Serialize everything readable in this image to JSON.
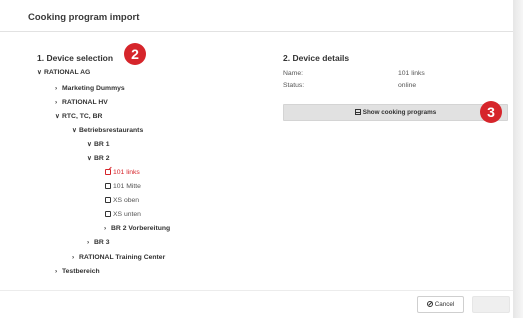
{
  "dialog": {
    "title": "Cooking program import"
  },
  "device_selection": {
    "title": "1. Device selection",
    "tree": [
      {
        "label": "RATIONAL AG",
        "chevron": "v"
      },
      {
        "label": "Marketing Dummys",
        "chevron": ">"
      },
      {
        "label": "RATIONAL HV",
        "chevron": ">"
      },
      {
        "label": "RTC, TC, BR",
        "chevron": "v"
      },
      {
        "label": "Betriebsrestaurants",
        "chevron": "v"
      },
      {
        "label": "BR 1",
        "chevron": "v"
      },
      {
        "label": "BR 2",
        "chevron": "v"
      },
      {
        "label": "101 links",
        "state": "selected"
      },
      {
        "label": "101 Mitte"
      },
      {
        "label": "XS oben"
      },
      {
        "label": "XS unten"
      },
      {
        "label": "BR 2 Vorbereitung",
        "chevron": ">"
      },
      {
        "label": "BR 3",
        "chevron": ">"
      },
      {
        "label": "RATIONAL Training Center",
        "chevron": ">"
      },
      {
        "label": "Testbereich",
        "chevron": ">"
      }
    ]
  },
  "device_details": {
    "title": "2. Device details",
    "name_label": "Name:",
    "name_value": "101 links",
    "status_label": "Status:",
    "status_value": "online",
    "show_button": "Show cooking programs"
  },
  "badges": {
    "b2": "2",
    "b3": "3"
  },
  "footer": {
    "cancel": "Cancel",
    "ok": ""
  },
  "colors": {
    "accent": "#d6252b",
    "button_bg": "#e1e1e1"
  }
}
